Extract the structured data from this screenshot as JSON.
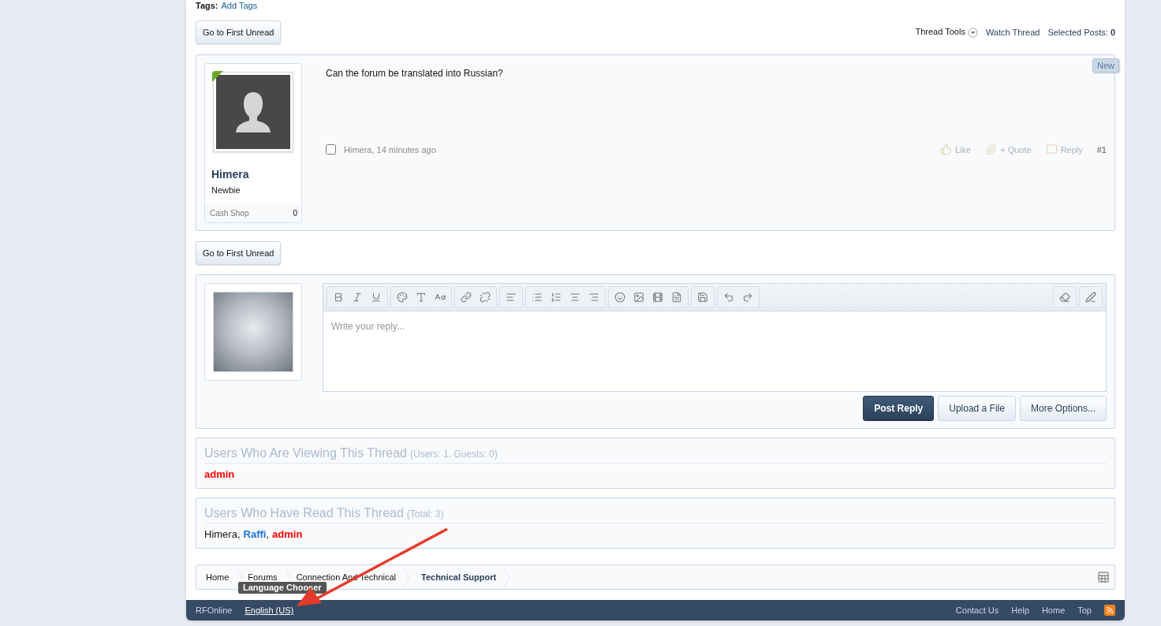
{
  "tags": {
    "label": "Tags:",
    "link": "Add Tags"
  },
  "top_bar": {
    "first_unread": "Go to First Unread",
    "thread_tools": "Thread Tools",
    "watch_thread": "Watch Thread",
    "selected_label": "Selected Posts:",
    "selected_count": "0"
  },
  "post": {
    "user": {
      "name": "Himera",
      "title": "Newbie",
      "stat_label": "Cash Shop",
      "stat_value": "0",
      "online": true
    },
    "badge": "New",
    "message": "Can the forum be translated into Russian?",
    "checked": false,
    "author_date": "Himera, 14 minutes ago",
    "actions": [
      {
        "kind": "like",
        "label": "Like"
      },
      {
        "kind": "quote",
        "label": "+ Quote"
      },
      {
        "kind": "reply",
        "label": "Reply"
      }
    ],
    "number": "#1"
  },
  "bottom_first_unread": "Go to First Unread",
  "reply": {
    "placeholder": "Write your reply...",
    "buttons": [
      {
        "label": "Post Reply",
        "kind": "primary"
      },
      {
        "label": "Upload a File",
        "kind": "secondary"
      },
      {
        "label": "More Options...",
        "kind": "secondary"
      }
    ]
  },
  "viewing": {
    "title": "Users Who Are Viewing This Thread",
    "meta": "(Users: 1, Guests: 0)",
    "users": [
      {
        "name": "admin",
        "color": "#ff0000",
        "kind": "bold"
      }
    ]
  },
  "read": {
    "title": "Users Who Have Read This Thread",
    "meta": "(Total: 3)",
    "separator": ",",
    "users": [
      {
        "name": "Himera",
        "color": "#141414",
        "kind": "plain"
      },
      {
        "name": "Raffi",
        "color": "#1e73d8",
        "kind": "bold"
      },
      {
        "name": "admin",
        "color": "#ff0000",
        "kind": "bold"
      }
    ]
  },
  "breadcrumb": [
    {
      "label": "Home",
      "selected": false
    },
    {
      "label": "Forums",
      "selected": false
    },
    {
      "label": "Connection And Technical",
      "selected": false
    },
    {
      "label": "Technical Support",
      "selected": true
    }
  ],
  "tooltip": "Language Chooser",
  "footer": {
    "site": "RFOnline",
    "language": "English (US)",
    "links": [
      "Contact Us",
      "Help",
      "Home",
      "Top"
    ]
  }
}
